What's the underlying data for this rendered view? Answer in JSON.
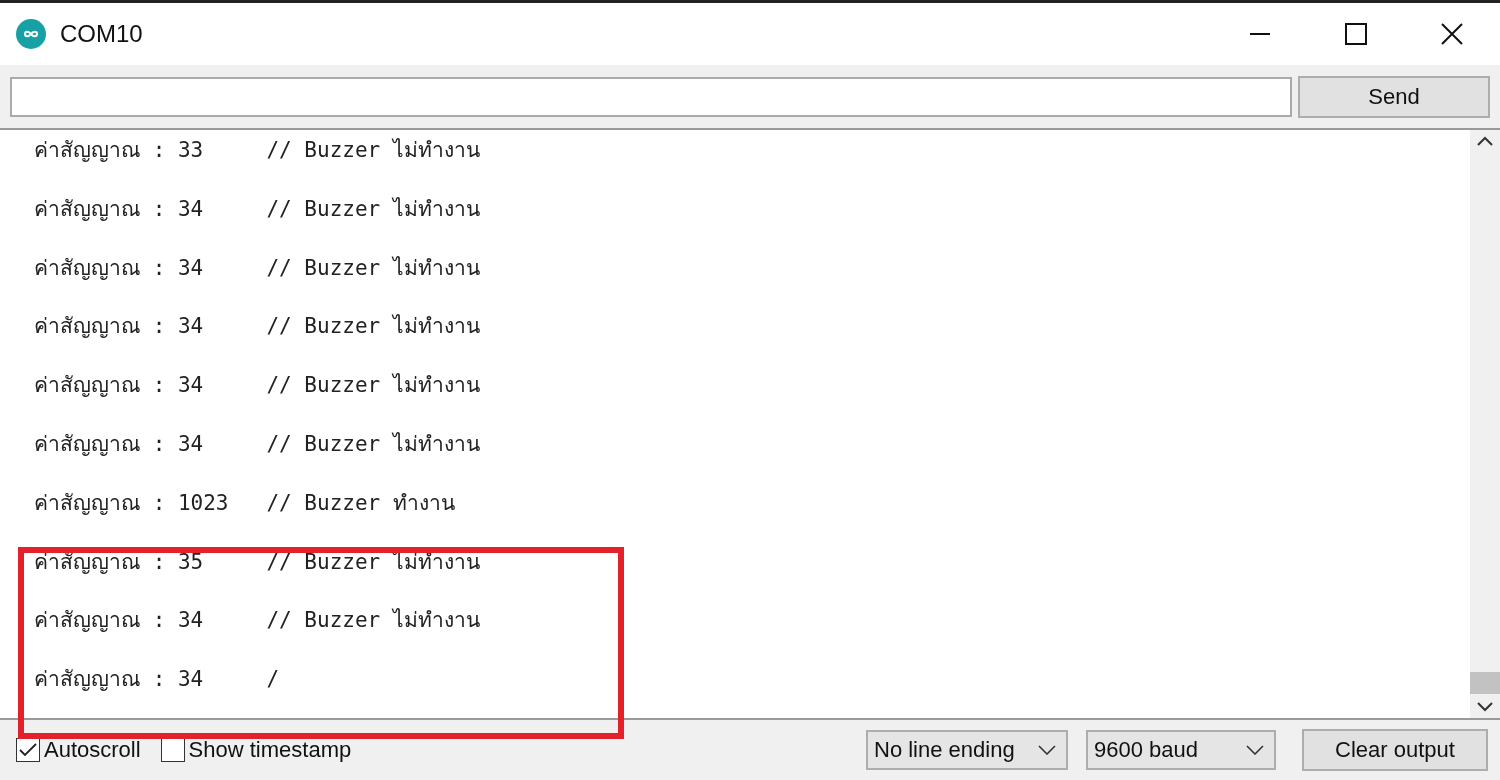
{
  "window": {
    "title": "COM10"
  },
  "input": {
    "send_label": "Send"
  },
  "output": {
    "lines": [
      {
        "text": "ค่าสัญญาณ : 33     // Buzzer ไม่ทำงาน",
        "highlighted": false
      },
      {
        "text": "ค่าสัญญาณ : 34     // Buzzer ไม่ทำงาน",
        "highlighted": false
      },
      {
        "text": "ค่าสัญญาณ : 34     // Buzzer ไม่ทำงาน",
        "highlighted": false
      },
      {
        "text": "ค่าสัญญาณ : 34     // Buzzer ไม่ทำงาน",
        "highlighted": false
      },
      {
        "text": "ค่าสัญญาณ : 34     // Buzzer ไม่ทำงาน",
        "highlighted": false
      },
      {
        "text": "ค่าสัญญาณ : 34     // Buzzer ไม่ทำงาน",
        "highlighted": false
      },
      {
        "text": "ค่าสัญญาณ : 1023   // Buzzer ทำงาน",
        "highlighted": false
      },
      {
        "text": "ค่าสัญญาณ : 35     // Buzzer ไม่ทำงาน",
        "highlighted": true
      },
      {
        "text": "ค่าสัญญาณ : 34     // Buzzer ไม่ทำงาน",
        "highlighted": true
      },
      {
        "text": "ค่าสัญญาณ : 34     /",
        "highlighted": true
      }
    ]
  },
  "footer": {
    "options": [
      {
        "label": "Autoscroll",
        "checked": true
      },
      {
        "label": "Show timestamp",
        "checked": false
      }
    ],
    "line_ending": "No line ending",
    "baud": "9600 baud",
    "clear_label": "Clear output"
  }
}
